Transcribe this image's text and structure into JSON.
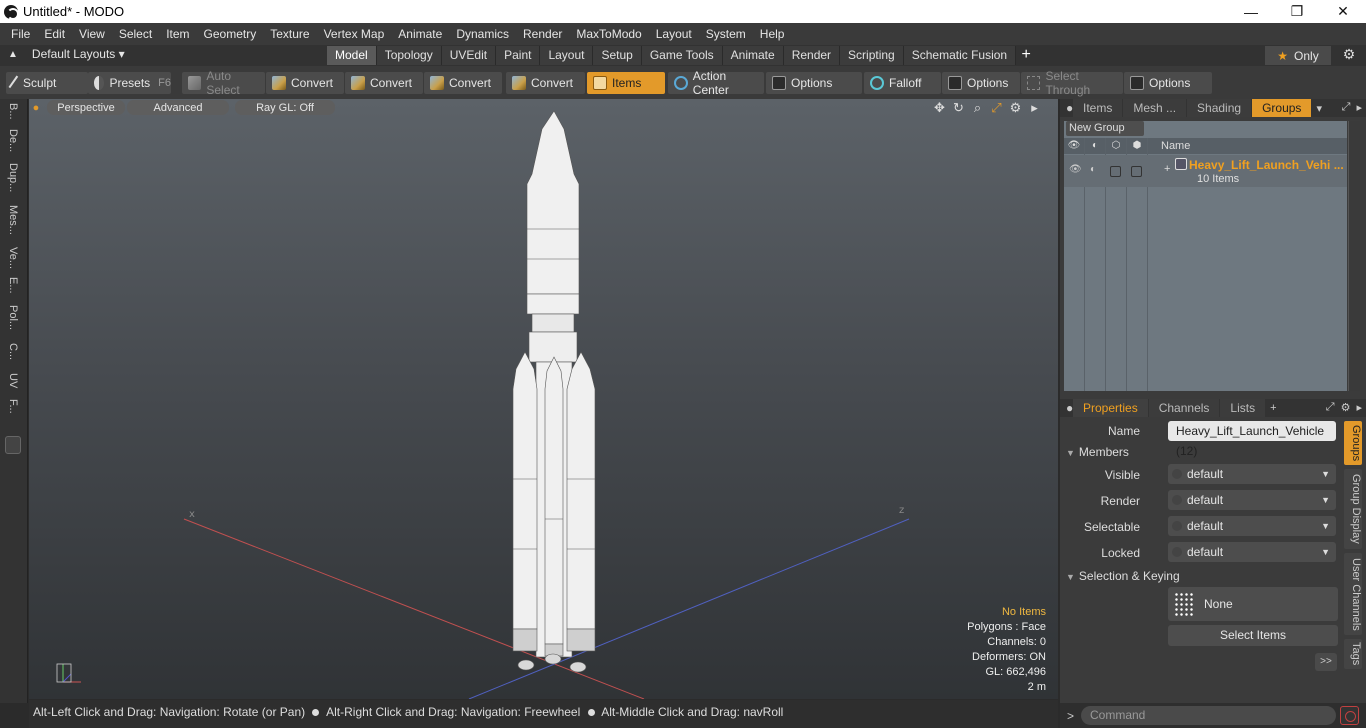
{
  "window": {
    "title": "Untitled* - MODO",
    "controls": [
      "—",
      "❐",
      "✕"
    ]
  },
  "menubar": [
    "File",
    "Edit",
    "View",
    "Select",
    "Item",
    "Geometry",
    "Texture",
    "Vertex Map",
    "Animate",
    "Dynamics",
    "Render",
    "MaxToModo",
    "Layout",
    "System",
    "Help"
  ],
  "layout_bar": {
    "layouts_label": "Default Layouts ▾",
    "tabs": [
      "Model",
      "Topology",
      "UVEdit",
      "Paint",
      "Layout",
      "Setup",
      "Game Tools",
      "Animate",
      "Render",
      "Scripting",
      "Schematic Fusion"
    ],
    "active_tab": "Model",
    "add_tab": "+",
    "only_label": "Only"
  },
  "toolbar": {
    "sculpt": "Sculpt",
    "presets": "Presets",
    "presets_key": "F6",
    "auto_select": "Auto Select",
    "convert1": "Convert",
    "convert2": "Convert",
    "convert3": "Convert",
    "convert4": "Convert",
    "items": "Items",
    "action_center": "Action Center",
    "options1": "Options",
    "falloff": "Falloff",
    "options2": "Options",
    "select_through": "Select Through",
    "options3": "Options"
  },
  "left_strip": [
    "B...",
    "De...",
    "Dup...",
    "Mes...",
    "Ve...",
    "E...",
    "Pol...",
    "C...",
    "UV",
    "F..."
  ],
  "viewport": {
    "tabs": [
      "Perspective",
      "Advanced",
      "Ray GL: Off"
    ],
    "stats": {
      "selection": "No Items",
      "polygons": "Polygons : Face",
      "channels": "Channels: 0",
      "deformers": "Deformers: ON",
      "gl": "GL: 662,496",
      "scale": "2 m"
    }
  },
  "statusbar": {
    "hint1": "Alt-Left Click and Drag: Navigation: Rotate (or Pan)",
    "hint2": "Alt-Right Click and Drag: Navigation: Freewheel",
    "hint3": "Alt-Middle Click and Drag: navRoll"
  },
  "groups_panel": {
    "tabs": [
      "Items",
      "Mesh ...",
      "Shading",
      "Groups"
    ],
    "active_tab": "Groups",
    "new_group": "New Group",
    "column_name": "Name",
    "group": {
      "name": "Heavy_Lift_Launch_Vehi ...",
      "count": "10 Items"
    }
  },
  "properties_panel": {
    "tabs": [
      "Properties",
      "Channels",
      "Lists"
    ],
    "active_tab": "Properties",
    "add_tab": "+",
    "name_label": "Name",
    "name_value": "Heavy_Lift_Launch_Vehicle (12)",
    "members_section": "Members",
    "visible_label": "Visible",
    "visible_value": "default",
    "render_label": "Render",
    "render_value": "default",
    "selectable_label": "Selectable",
    "selectable_value": "default",
    "locked_label": "Locked",
    "locked_value": "default",
    "selection_section": "Selection & Keying",
    "none_button": "None",
    "select_items_button": "Select Items",
    "more_button": ">>",
    "side_tabs": [
      "Groups",
      "Group Display",
      "User Channels",
      "Tags"
    ]
  },
  "command": {
    "placeholder": "Command"
  },
  "colors": {
    "accent": "#e39a2a",
    "viewport_top": "#5c6268",
    "viewport_bottom": "#303336"
  }
}
